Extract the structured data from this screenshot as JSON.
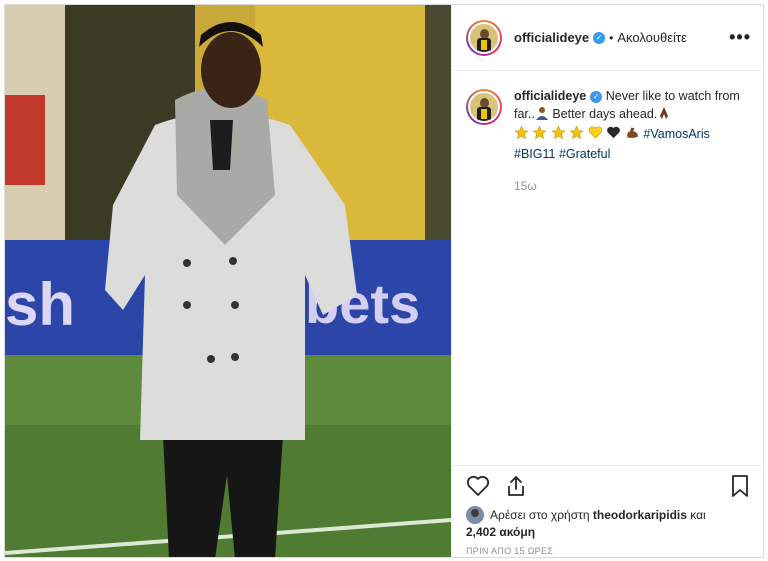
{
  "post": {
    "username": "officialideye",
    "verified_icon": "verified-badge-icon",
    "separator": "•",
    "follow_status": "Ακολουθείτε",
    "more_label": "•••",
    "caption": {
      "username": "officialideye",
      "text_1": "Never like to watch from far..",
      "text_2": " Better days ahead.",
      "hashtags": [
        "#VamosAris",
        "#BIG11",
        "#Grateful"
      ],
      "emojis": [
        "star",
        "star",
        "star",
        "star",
        "yellow-heart",
        "black-heart",
        "flexed-biceps"
      ]
    },
    "time_ago": "15ω",
    "likes": {
      "prefix": "Αρέσει στο χρήστη",
      "user": "theodorkaripidis",
      "joiner": "και",
      "count": "2,402 ακόμη"
    },
    "posted": "ΠΡΙΝ ΑΠΟ 15 ΩΡΕΣ"
  },
  "colors": {
    "link": "#003569",
    "verified": "#3897f0",
    "muted": "#8e8e8e",
    "border": "#efefef"
  }
}
